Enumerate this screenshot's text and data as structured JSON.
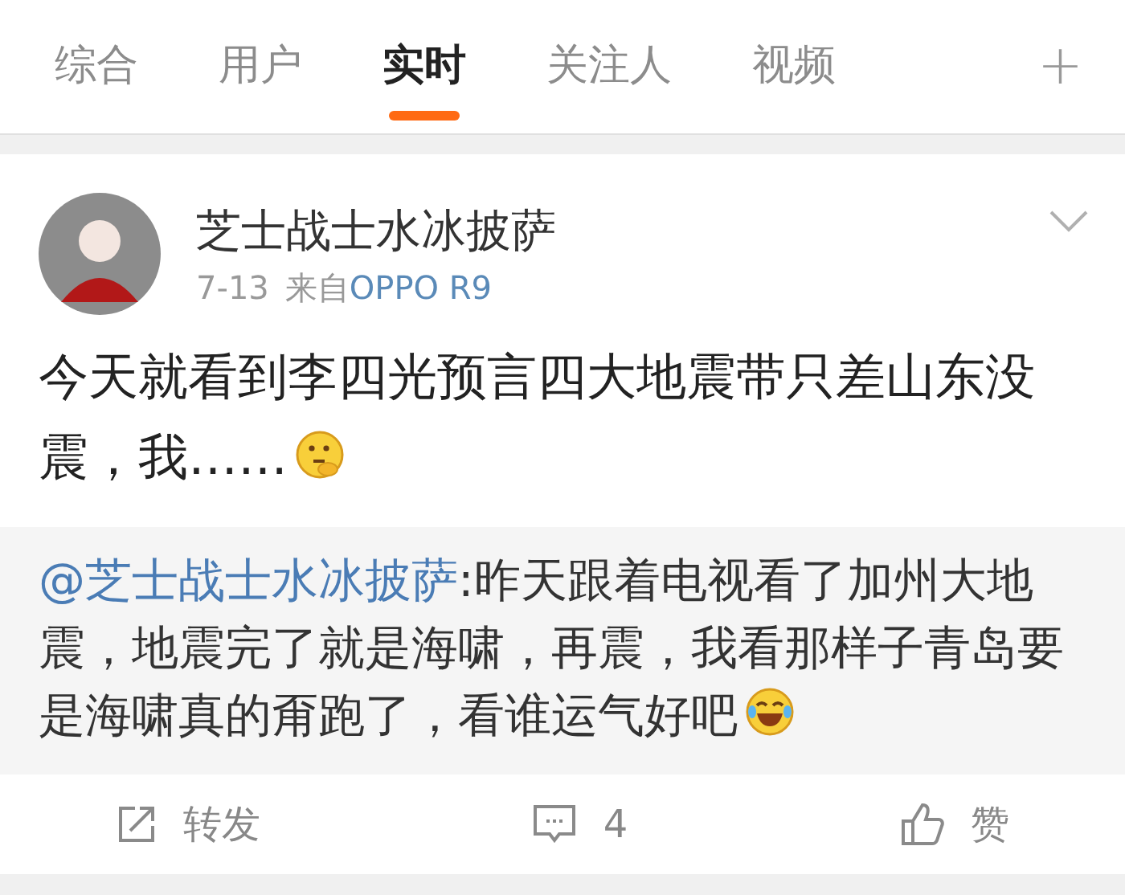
{
  "tabs": [
    {
      "label": "综合",
      "selected": false
    },
    {
      "label": "用户",
      "selected": false
    },
    {
      "label": "实时",
      "selected": true
    },
    {
      "label": "关注人",
      "selected": false
    },
    {
      "label": "视频",
      "selected": false
    }
  ],
  "add_tab": "+",
  "post": {
    "author": "芝士战士水冰披萨",
    "date": "7-13",
    "source_prefix": "来自",
    "source": "OPPO R9",
    "text": "今天就看到李四光预言四大地震带只差山东没震，我……",
    "quoted": {
      "mention": "@芝士战士水冰披萨",
      "text": ":昨天跟着电视看了加州大地震，地震完了就是海啸，再震，我看那样子青岛要是海啸真的甭跑了，看谁运气好吧"
    },
    "actions": [
      {
        "kind": "repost",
        "label": "转发"
      },
      {
        "kind": "comment",
        "label": "4"
      },
      {
        "kind": "like",
        "label": "赞"
      }
    ]
  }
}
